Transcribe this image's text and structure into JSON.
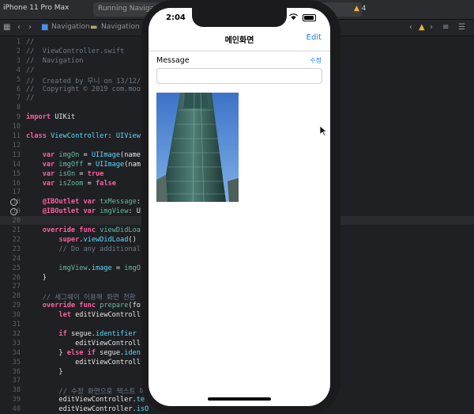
{
  "xcode": {
    "scheme": "iPhone 11 Pro Max",
    "status": "Running Navigat",
    "warning_count": "4",
    "jumpbar": [
      "Navigation",
      "Navigation"
    ]
  },
  "editor": {
    "lines": [
      {
        "n": "1",
        "html": "<span class='cm'>//</span>"
      },
      {
        "n": "2",
        "html": "<span class='cm'>//  ViewController.swift</span>"
      },
      {
        "n": "3",
        "html": "<span class='cm'>//  Navigation</span>"
      },
      {
        "n": "4",
        "html": "<span class='cm'>//</span>"
      },
      {
        "n": "5",
        "html": "<span class='cm'>//  Created by 무니 on 13/12/</span>"
      },
      {
        "n": "6",
        "html": "<span class='cm'>//  Copyright © 2019 com.moo</span>"
      },
      {
        "n": "7",
        "html": "<span class='cm'>//</span>"
      },
      {
        "n": "8",
        "html": ""
      },
      {
        "n": "9",
        "html": "<span class='kw'>import</span> UIKit"
      },
      {
        "n": "10",
        "html": ""
      },
      {
        "n": "11",
        "html": "<span class='kw'>class</span> <span class='ty'>ViewController</span>: <span class='ty'>UIView</span>"
      },
      {
        "n": "12",
        "html": ""
      },
      {
        "n": "13",
        "html": "    <span class='kw'>var</span> <span class='id'>imgOn</span> = <span class='ty'>UIImage</span>(name"
      },
      {
        "n": "14",
        "html": "    <span class='kw'>var</span> <span class='id'>imgOff</span> = <span class='ty'>UIImage</span>(nam"
      },
      {
        "n": "15",
        "html": "    <span class='kw'>var</span> <span class='id'>isOn</span> = <span class='kw'>true</span>"
      },
      {
        "n": "16",
        "html": "    <span class='kw'>var</span> <span class='id'>isZoom</span> = <span class='kw'>false</span>"
      },
      {
        "n": "17",
        "html": ""
      },
      {
        "n": "18",
        "html": "    <span class='kw'>@IBOutlet</span> <span class='kw'>var</span> <span class='id'>txMessage</span>:"
      },
      {
        "n": "19",
        "html": "    <span class='kw'>@IBOutlet</span> <span class='kw'>var</span> <span class='id'>imgView</span>: U"
      },
      {
        "n": "20",
        "html": ""
      },
      {
        "n": "21",
        "html": "    <span class='kw'>override</span> <span class='kw'>func</span> <span class='id'>viewDidLoa</span>"
      },
      {
        "n": "22",
        "html": "        <span class='kw'>super</span>.<span class='ty'>viewDidLoad</span>()"
      },
      {
        "n": "23",
        "html": "        <span class='cm'>// Do any additional</span>"
      },
      {
        "n": "24",
        "html": ""
      },
      {
        "n": "25",
        "html": "        <span class='id'>imgView</span>.<span class='ty'>image</span> = <span class='id'>imgO</span>"
      },
      {
        "n": "26",
        "html": "    }"
      },
      {
        "n": "27",
        "html": ""
      },
      {
        "n": "28",
        "html": "    <span class='cm'>// 세그웨이 이용해 화면 전환</span>"
      },
      {
        "n": "29",
        "html": "    <span class='kw'>override</span> <span class='kw'>func</span> <span class='id'>prepare</span>(fo"
      },
      {
        "n": "30",
        "html": "        <span class='kw'>let</span> editViewControll"
      },
      {
        "n": "31",
        "html": ""
      },
      {
        "n": "32",
        "html": "        <span class='kw'>if</span> segue.<span class='ty'>identifier</span>"
      },
      {
        "n": "33",
        "html": "            editViewControll"
      },
      {
        "n": "34",
        "html": "        } <span class='kw'>else if</span> segue.<span class='ty'>iden</span>"
      },
      {
        "n": "35",
        "html": "            editViewControll"
      },
      {
        "n": "36",
        "html": "        }"
      },
      {
        "n": "37",
        "html": ""
      },
      {
        "n": "38",
        "html": "        <span class='cm'>// 수정 화면으로 텍스트 메</span>"
      },
      {
        "n": "39",
        "html": "        editViewController.<span class='ty'>te</span>"
      },
      {
        "n": "40",
        "html": "        editViewController.<span class='ty'>isO</span>"
      }
    ]
  },
  "phone": {
    "time": "2:04",
    "nav_title": "메인화면",
    "nav_edit": "Edit",
    "message_label": "Message",
    "message_edit": "수정",
    "message_value": ""
  }
}
